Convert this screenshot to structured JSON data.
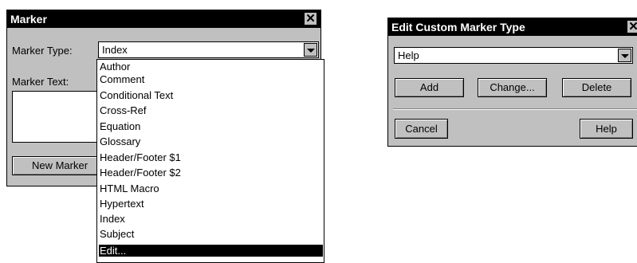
{
  "marker_dialog": {
    "title": "Marker",
    "close_glyph": "✕",
    "marker_type_label": "Marker Type:",
    "marker_type_value": "Index",
    "marker_text_label": "Marker Text:",
    "new_marker_button": "New Marker",
    "dropdown_items": [
      "Author",
      "Comment",
      "Conditional Text",
      "Cross-Ref",
      "Equation",
      "Glossary",
      "Header/Footer $1",
      "Header/Footer $2",
      "HTML Macro",
      "Hypertext",
      "Index",
      "Subject",
      "Edit..."
    ],
    "selected_item": "Edit..."
  },
  "edit_dialog": {
    "title": "Edit Custom Marker Type",
    "close_glyph": "✕",
    "combo_value": "Help",
    "add_button": "Add",
    "change_button": "Change...",
    "delete_button": "Delete",
    "cancel_button": "Cancel",
    "help_button": "Help"
  },
  "colors": {
    "face": "#c0c0c0",
    "titlebar": "#000000",
    "selection": "#000000"
  }
}
